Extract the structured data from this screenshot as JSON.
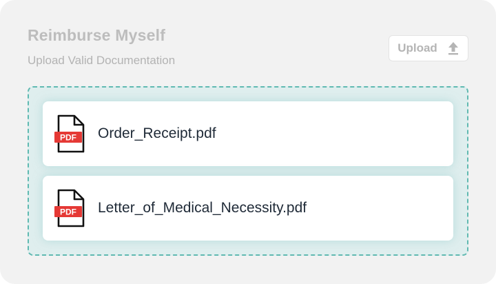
{
  "header": {
    "title": "Reimburse Myself",
    "subtitle": "Upload Valid Documentation"
  },
  "upload_button": {
    "label": "Upload",
    "icon": "upload-arrow-icon"
  },
  "files": [
    {
      "name": "Order_Receipt.pdf",
      "icon": "pdf-file-icon",
      "badge": "PDF"
    },
    {
      "name": "Letter_of_Medical_Necessity.pdf",
      "icon": "pdf-file-icon",
      "badge": "PDF"
    }
  ],
  "colors": {
    "card_bg": "#f2f2f2",
    "dropzone_border": "#5fb9b1",
    "dropzone_bg": "#dfeeee",
    "pdf_red": "#e53935",
    "muted_text": "#bdbdbd",
    "file_text": "#1f2a37"
  }
}
